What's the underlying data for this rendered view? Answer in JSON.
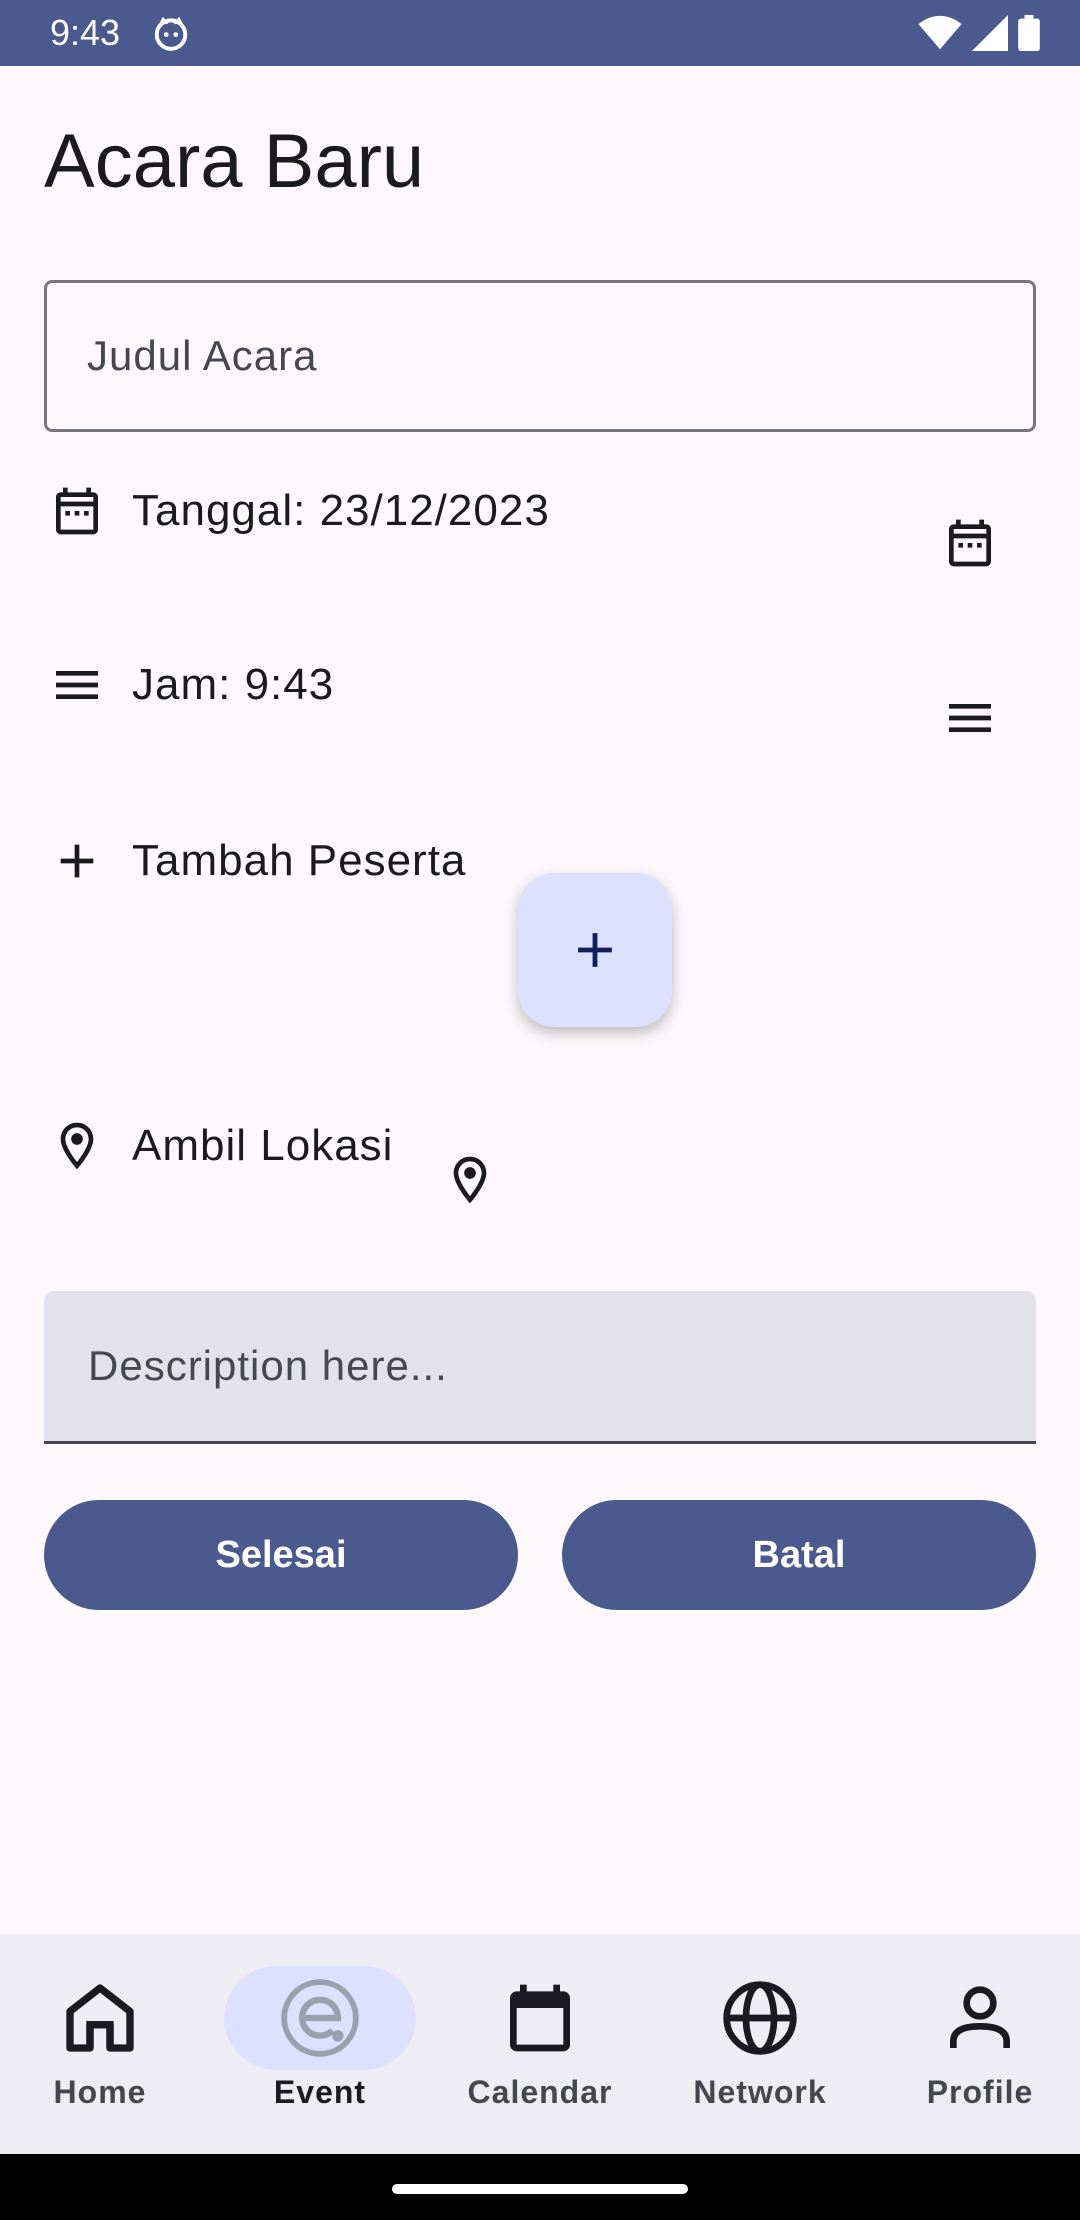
{
  "status_bar": {
    "time": "9:43"
  },
  "page": {
    "title": "Acara Baru"
  },
  "form": {
    "title_placeholder": "Judul Acara",
    "title_value": "",
    "date_label": "Tanggal: 23/12/2023",
    "time_label": "Jam: 9:43",
    "participant_label": "Tambah Peserta",
    "location_label": "Ambil Lokasi",
    "description_placeholder": "Description here...",
    "description_value": ""
  },
  "buttons": {
    "done": "Selesai",
    "cancel": "Batal"
  },
  "bottom_nav": {
    "items": [
      {
        "label": "Home",
        "icon": "home-icon"
      },
      {
        "label": "Event",
        "icon": "event-icon",
        "active": true
      },
      {
        "label": "Calendar",
        "icon": "calendar-icon"
      },
      {
        "label": "Network",
        "icon": "globe-icon"
      },
      {
        "label": "Profile",
        "icon": "person-icon"
      }
    ]
  },
  "colors": {
    "primary": "#4A5A8E",
    "primary_container": "#DCE1FF",
    "background": "#FDF8FC",
    "nav_background": "#EFEDF4",
    "field_background": "#E2E1EC"
  }
}
